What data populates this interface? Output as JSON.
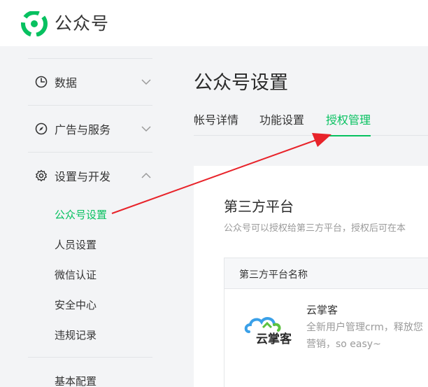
{
  "header": {
    "brand": "公众号"
  },
  "sidebar": {
    "menus": [
      {
        "label": "数据",
        "icon": "pie-chart-icon",
        "expanded": false
      },
      {
        "label": "广告与服务",
        "icon": "compass-icon",
        "expanded": false
      },
      {
        "label": "设置与开发",
        "icon": "gear-icon",
        "expanded": true
      }
    ],
    "sub_items": [
      {
        "label": "公众号设置",
        "active": true
      },
      {
        "label": "人员设置",
        "active": false
      },
      {
        "label": "微信认证",
        "active": false
      },
      {
        "label": "安全中心",
        "active": false
      },
      {
        "label": "违规记录",
        "active": false
      }
    ],
    "extra_item": "基本配置"
  },
  "main": {
    "title": "公众号设置",
    "tabs": [
      {
        "label": "帐号详情",
        "active": false
      },
      {
        "label": "功能设置",
        "active": false
      },
      {
        "label": "授权管理",
        "active": true
      }
    ],
    "section": {
      "title": "第三方平台",
      "description": "公众号可以授权给第三方平台，授权后可在本"
    },
    "table": {
      "header": "第三方平台名称",
      "row": {
        "logo_text": "云掌客",
        "name": "云掌客",
        "description": "全新用户管理crm，释放您营销，so easy~"
      }
    }
  },
  "colors": {
    "accent": "#07c160",
    "annotation": "#e8232a"
  }
}
